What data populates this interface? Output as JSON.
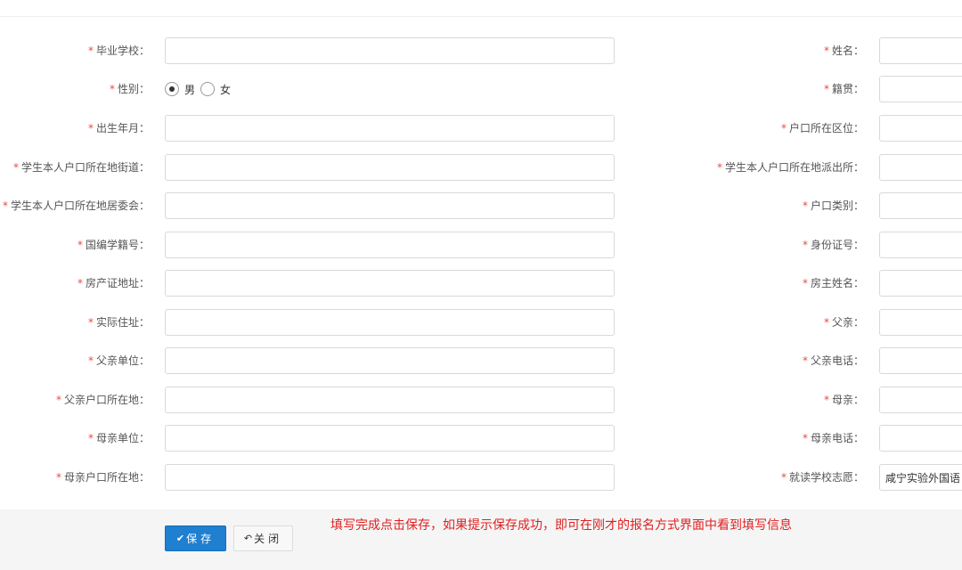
{
  "form": {
    "left": [
      {
        "label": "毕业学校：",
        "value": ""
      },
      {
        "label": "性别：",
        "type": "radio",
        "options": [
          "男",
          "女"
        ],
        "selected": 0
      },
      {
        "label": "出生年月：",
        "value": ""
      },
      {
        "label": "学生本人户口所在地街道：",
        "value": ""
      },
      {
        "label": "学生本人户口所在地居委会：",
        "value": ""
      },
      {
        "label": "国编学籍号：",
        "value": ""
      },
      {
        "label": "房产证地址：",
        "value": ""
      },
      {
        "label": "实际住址：",
        "value": ""
      },
      {
        "label": "父亲单位：",
        "value": ""
      },
      {
        "label": "父亲户口所在地：",
        "value": ""
      },
      {
        "label": "母亲单位：",
        "value": ""
      },
      {
        "label": "母亲户口所在地：",
        "value": ""
      }
    ],
    "right": [
      {
        "label": "姓名：",
        "value": ""
      },
      {
        "label": "籍贯：",
        "value": ""
      },
      {
        "label": "户口所在区位：",
        "value": ""
      },
      {
        "label": "学生本人户口所在地派出所：",
        "value": ""
      },
      {
        "label": "户口类别：",
        "value": ""
      },
      {
        "label": "身份证号：",
        "value": ""
      },
      {
        "label": "房主姓名：",
        "value": ""
      },
      {
        "label": "父亲：",
        "value": ""
      },
      {
        "label": "父亲电话：",
        "value": ""
      },
      {
        "label": "母亲：",
        "value": ""
      },
      {
        "label": "母亲电话：",
        "value": ""
      },
      {
        "label": "就读学校志愿：",
        "value": "咸宁实验外国语"
      }
    ],
    "required_mark": "*"
  },
  "footer": {
    "save_label": "保存",
    "close_label": "关闭",
    "save_icon": "check-icon",
    "close_icon": "undo-arrow-icon",
    "notice": "填写完成点击保存，如果提示保存成功，即可在刚才的报名方式界面中看到填写信息"
  },
  "colors": {
    "required": "#e54d42",
    "primary_button": "#1f7fd0",
    "notice_text": "#e02020",
    "footer_bg": "#f5f5f5"
  }
}
